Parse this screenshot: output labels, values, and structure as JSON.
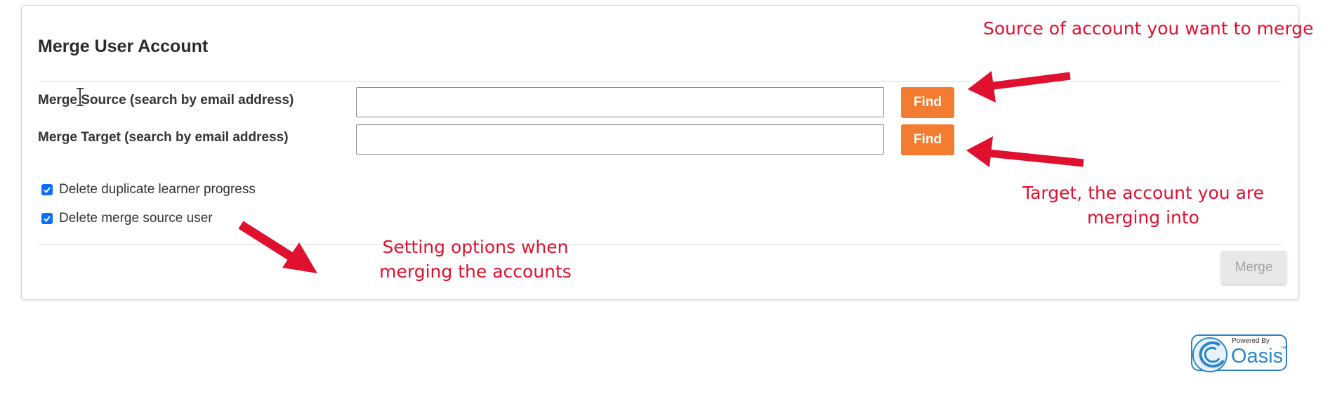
{
  "card": {
    "title": "Merge User Account"
  },
  "fields": {
    "source": {
      "label": "Merge Source (search by email address)",
      "value": "",
      "button_label": "Find"
    },
    "target": {
      "label": "Merge Target (search by email address)",
      "value": "",
      "button_label": "Find"
    }
  },
  "options": [
    {
      "label": "Delete duplicate learner progress",
      "checked": true
    },
    {
      "label": "Delete merge source user",
      "checked": true
    }
  ],
  "actions": {
    "merge_label": "Merge",
    "merge_disabled": true
  },
  "annotations": {
    "source": "Source of account you want to merge",
    "target_line1": "Target, the account you are",
    "target_line2": "merging into",
    "options_line1": "Setting options when",
    "options_line2": "merging the accounts"
  },
  "footer": {
    "powered_by": "Powered By",
    "brand": "Oasis",
    "trademark": "™"
  },
  "colors": {
    "accent_find": "#f47c30",
    "annotation_red": "#e0102f",
    "checkbox_blue": "#0d6efd",
    "logo_blue": "#2a86c9"
  },
  "icons": {
    "cursor": "text-cursor-icon",
    "arrows": "red-arrow-icon",
    "checkbox": "checkmark-icon"
  }
}
